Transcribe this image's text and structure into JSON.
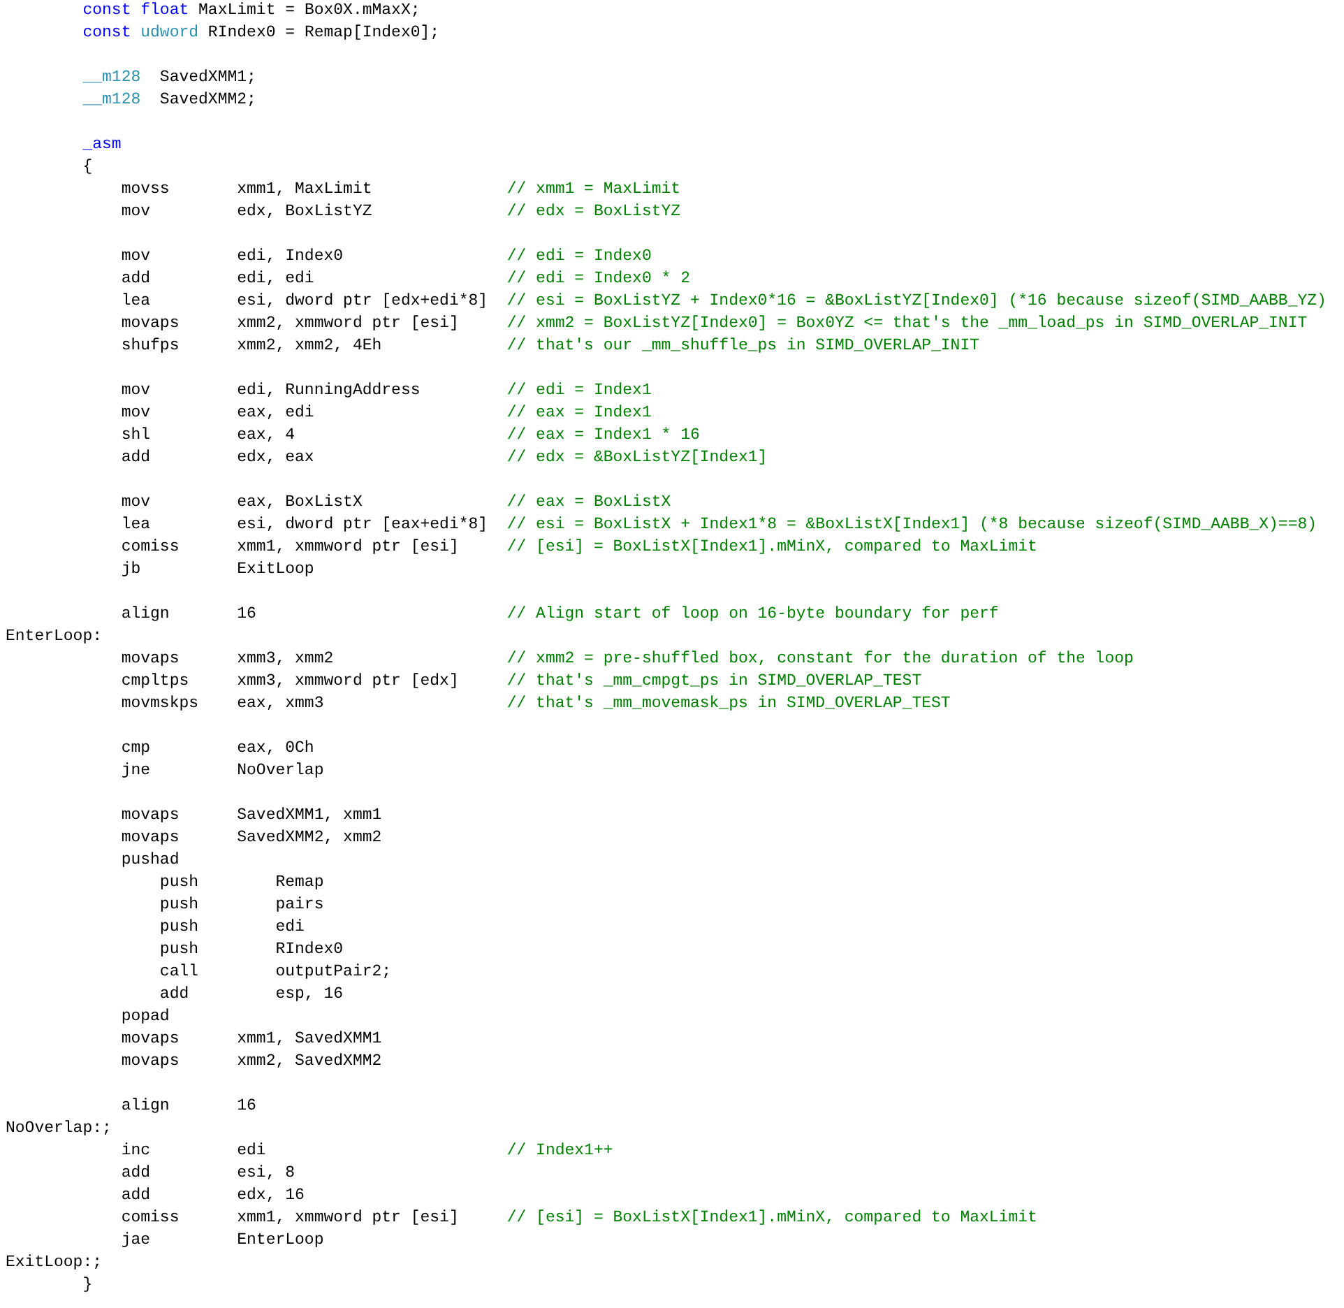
{
  "editor": {
    "lines": [
      {
        "kind": "code",
        "parts": [
          {
            "kind": "keyword",
            "text": "        const float"
          },
          {
            "kind": "plain",
            "text": " MaxLimit = Box0X.mMaxX;"
          }
        ]
      },
      {
        "kind": "code",
        "parts": [
          {
            "kind": "keyword",
            "text": "        const"
          },
          {
            "kind": "type",
            "text": " udword"
          },
          {
            "kind": "plain",
            "text": " RIndex0 = Remap[Index0];"
          }
        ]
      },
      {
        "kind": "blank"
      },
      {
        "kind": "code",
        "parts": [
          {
            "kind": "type",
            "text": "        __m128"
          },
          {
            "kind": "plain",
            "text": "  SavedXMM1;"
          }
        ]
      },
      {
        "kind": "code",
        "parts": [
          {
            "kind": "type",
            "text": "        __m128"
          },
          {
            "kind": "plain",
            "text": "  SavedXMM2;"
          }
        ]
      },
      {
        "kind": "blank"
      },
      {
        "kind": "code",
        "parts": [
          {
            "kind": "keyword",
            "text": "        _asm"
          }
        ]
      },
      {
        "kind": "code",
        "parts": [
          {
            "kind": "plain",
            "text": "        {"
          }
        ]
      },
      {
        "kind": "code",
        "parts": [
          {
            "kind": "plain",
            "text": "            movss       xmm1, MaxLimit"
          }
        ],
        "comment": "// xmm1 = MaxLimit"
      },
      {
        "kind": "code",
        "parts": [
          {
            "kind": "plain",
            "text": "            mov         edx, BoxListYZ"
          }
        ],
        "comment": "// edx = BoxListYZ"
      },
      {
        "kind": "blank"
      },
      {
        "kind": "code",
        "parts": [
          {
            "kind": "plain",
            "text": "            mov         edi, Index0"
          }
        ],
        "comment": "// edi = Index0"
      },
      {
        "kind": "code",
        "parts": [
          {
            "kind": "plain",
            "text": "            add         edi, edi"
          }
        ],
        "comment": "// edi = Index0 * 2"
      },
      {
        "kind": "code",
        "parts": [
          {
            "kind": "plain",
            "text": "            lea         esi, dword ptr [edx+edi*8]"
          }
        ],
        "comment": "// esi = BoxListYZ + Index0*16 = &BoxListYZ[Index0] (*16 because sizeof(SIMD_AABB_YZ)"
      },
      {
        "kind": "code",
        "parts": [
          {
            "kind": "plain",
            "text": "            movaps      xmm2, xmmword ptr [esi]"
          }
        ],
        "comment": "// xmm2 = BoxListYZ[Index0] = Box0YZ <= that's the _mm_load_ps in SIMD_OVERLAP_INIT"
      },
      {
        "kind": "code",
        "parts": [
          {
            "kind": "plain",
            "text": "            shufps      xmm2, xmm2, 4Eh"
          }
        ],
        "comment": "// that's our _mm_shuffle_ps in SIMD_OVERLAP_INIT"
      },
      {
        "kind": "blank"
      },
      {
        "kind": "code",
        "parts": [
          {
            "kind": "plain",
            "text": "            mov         edi, RunningAddress"
          }
        ],
        "comment": "// edi = Index1"
      },
      {
        "kind": "code",
        "parts": [
          {
            "kind": "plain",
            "text": "            mov         eax, edi"
          }
        ],
        "comment": "// eax = Index1"
      },
      {
        "kind": "code",
        "parts": [
          {
            "kind": "plain",
            "text": "            shl         eax, 4"
          }
        ],
        "comment": "// eax = Index1 * 16"
      },
      {
        "kind": "code",
        "parts": [
          {
            "kind": "plain",
            "text": "            add         edx, eax"
          }
        ],
        "comment": "// edx = &BoxListYZ[Index1]"
      },
      {
        "kind": "blank"
      },
      {
        "kind": "code",
        "parts": [
          {
            "kind": "plain",
            "text": "            mov         eax, BoxListX"
          }
        ],
        "comment": "// eax = BoxListX"
      },
      {
        "kind": "code",
        "parts": [
          {
            "kind": "plain",
            "text": "            lea         esi, dword ptr [eax+edi*8]"
          }
        ],
        "comment": "// esi = BoxListX + Index1*8 = &BoxListX[Index1] (*8 because sizeof(SIMD_AABB_X)==8)"
      },
      {
        "kind": "code",
        "parts": [
          {
            "kind": "plain",
            "text": "            comiss      xmm1, xmmword ptr [esi]"
          }
        ],
        "comment": "// [esi] = BoxListX[Index1].mMinX, compared to MaxLimit"
      },
      {
        "kind": "code",
        "parts": [
          {
            "kind": "plain",
            "text": "            jb          ExitLoop"
          }
        ]
      },
      {
        "kind": "blank"
      },
      {
        "kind": "code",
        "parts": [
          {
            "kind": "plain",
            "text": "            align       16"
          }
        ],
        "comment": "// Align start of loop on 16-byte boundary for perf"
      },
      {
        "kind": "code",
        "parts": [
          {
            "kind": "plain",
            "text": "EnterLoop:"
          }
        ]
      },
      {
        "kind": "code",
        "parts": [
          {
            "kind": "plain",
            "text": "            movaps      xmm3, xmm2"
          }
        ],
        "comment": "// xmm2 = pre-shuffled box, constant for the duration of the loop"
      },
      {
        "kind": "code",
        "parts": [
          {
            "kind": "plain",
            "text": "            cmpltps     xmm3, xmmword ptr [edx]"
          }
        ],
        "comment": "// that's _mm_cmpgt_ps in SIMD_OVERLAP_TEST"
      },
      {
        "kind": "code",
        "parts": [
          {
            "kind": "plain",
            "text": "            movmskps    eax, xmm3"
          }
        ],
        "comment": "// that's _mm_movemask_ps in SIMD_OVERLAP_TEST"
      },
      {
        "kind": "blank"
      },
      {
        "kind": "code",
        "parts": [
          {
            "kind": "plain",
            "text": "            cmp         eax, 0Ch"
          }
        ]
      },
      {
        "kind": "code",
        "parts": [
          {
            "kind": "plain",
            "text": "            jne         NoOverlap"
          }
        ]
      },
      {
        "kind": "blank"
      },
      {
        "kind": "code",
        "parts": [
          {
            "kind": "plain",
            "text": "            movaps      SavedXMM1, xmm1"
          }
        ]
      },
      {
        "kind": "code",
        "parts": [
          {
            "kind": "plain",
            "text": "            movaps      SavedXMM2, xmm2"
          }
        ]
      },
      {
        "kind": "code",
        "parts": [
          {
            "kind": "plain",
            "text": "            pushad"
          }
        ]
      },
      {
        "kind": "code",
        "parts": [
          {
            "kind": "plain",
            "text": "                push        Remap"
          }
        ]
      },
      {
        "kind": "code",
        "parts": [
          {
            "kind": "plain",
            "text": "                push        pairs"
          }
        ]
      },
      {
        "kind": "code",
        "parts": [
          {
            "kind": "plain",
            "text": "                push        edi"
          }
        ]
      },
      {
        "kind": "code",
        "parts": [
          {
            "kind": "plain",
            "text": "                push        RIndex0"
          }
        ]
      },
      {
        "kind": "code",
        "parts": [
          {
            "kind": "plain",
            "text": "                call        outputPair2;"
          }
        ]
      },
      {
        "kind": "code",
        "parts": [
          {
            "kind": "plain",
            "text": "                add         esp, 16"
          }
        ]
      },
      {
        "kind": "code",
        "parts": [
          {
            "kind": "plain",
            "text": "            popad"
          }
        ]
      },
      {
        "kind": "code",
        "parts": [
          {
            "kind": "plain",
            "text": "            movaps      xmm1, SavedXMM1"
          }
        ]
      },
      {
        "kind": "code",
        "parts": [
          {
            "kind": "plain",
            "text": "            movaps      xmm2, SavedXMM2"
          }
        ]
      },
      {
        "kind": "blank"
      },
      {
        "kind": "code",
        "parts": [
          {
            "kind": "plain",
            "text": "            align       16"
          }
        ]
      },
      {
        "kind": "code",
        "parts": [
          {
            "kind": "plain",
            "text": "NoOverlap:;"
          }
        ]
      },
      {
        "kind": "code",
        "parts": [
          {
            "kind": "plain",
            "text": "            inc         edi"
          }
        ],
        "comment": "// Index1++"
      },
      {
        "kind": "code",
        "parts": [
          {
            "kind": "plain",
            "text": "            add         esi, 8"
          }
        ]
      },
      {
        "kind": "code",
        "parts": [
          {
            "kind": "plain",
            "text": "            add         edx, 16"
          }
        ]
      },
      {
        "kind": "code",
        "parts": [
          {
            "kind": "plain",
            "text": "            comiss      xmm1, xmmword ptr [esi]"
          }
        ],
        "comment": "// [esi] = BoxListX[Index1].mMinX, compared to MaxLimit"
      },
      {
        "kind": "code",
        "parts": [
          {
            "kind": "plain",
            "text": "            jae         EnterLoop"
          }
        ]
      },
      {
        "kind": "code",
        "parts": [
          {
            "kind": "plain",
            "text": "ExitLoop:;"
          }
        ]
      },
      {
        "kind": "code",
        "parts": [
          {
            "kind": "plain",
            "text": "        }"
          }
        ]
      }
    ]
  }
}
